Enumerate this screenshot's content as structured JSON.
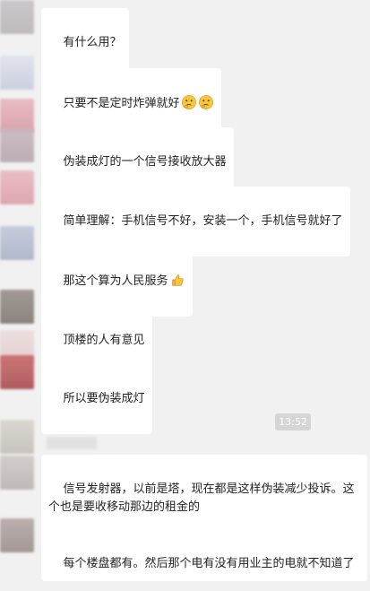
{
  "messages": [
    {
      "text": "有什么用？"
    },
    {
      "text": "只要不是定时炸弹就好",
      "emojis": [
        "thinking-face-icon",
        "thinking-face-icon"
      ]
    },
    {
      "text": "伪装成灯的一个信号接收放大器"
    },
    {
      "text": "简单理解：手机信号不好，安装一个，手机信号就好了"
    },
    {
      "text": "那这个算为人民服务",
      "emojis": [
        "thumbs-up-icon"
      ]
    },
    {
      "text": "顶楼的人有意见"
    },
    {
      "text": "所以要伪装成灯"
    },
    {
      "text": "信号发射器，以前是塔，现在都是这样伪装减少投诉。这个也是要收移动那边的租金的"
    },
    {
      "text": "每个楼盘都有。然后那个电有没有用业主的电就不知道了"
    }
  ],
  "timestamp": "13:52",
  "colors": {
    "background": "#f1f1f1",
    "bubble": "#ffffff",
    "timestamp_bg": "#d5d5d5"
  }
}
